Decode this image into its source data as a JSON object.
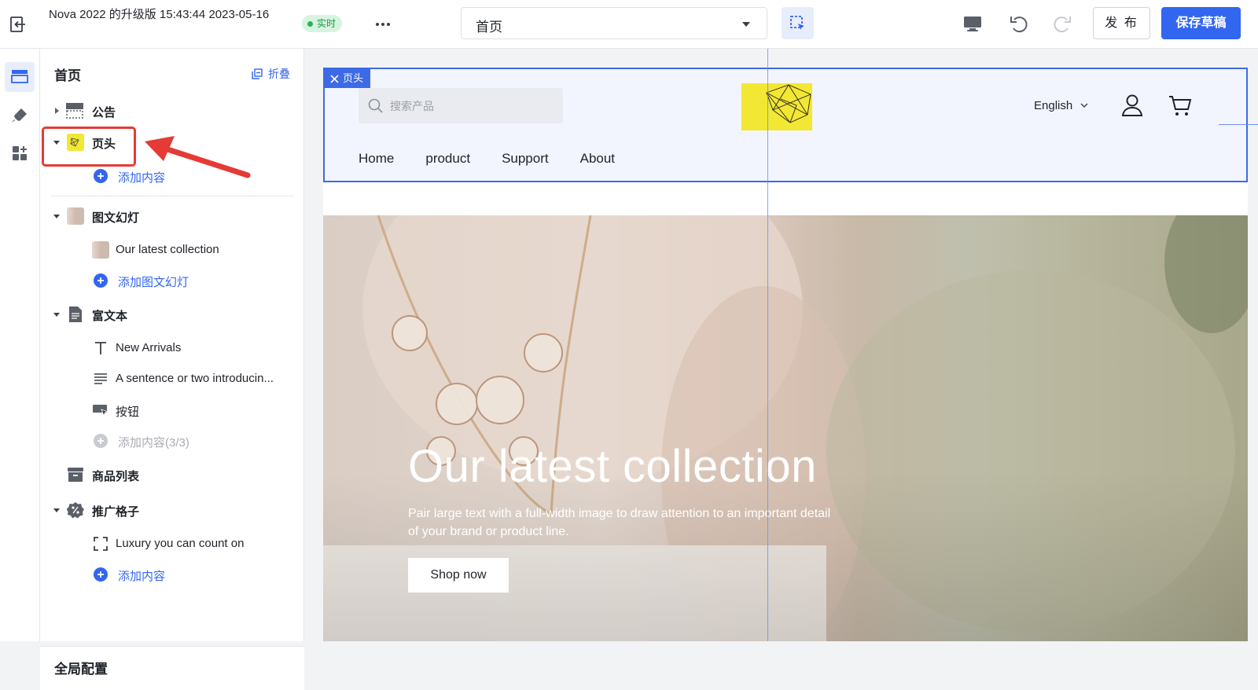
{
  "topbar": {
    "document_title": "Nova 2022 的升级版 15:43:44 2023-05-16",
    "live_badge": "实时",
    "page_selector_value": "首页",
    "publish_label": "发 布",
    "save_draft_label": "保存草稿"
  },
  "sidebar": {
    "title": "首页",
    "collapse_label": "折叠",
    "items": [
      {
        "label": "公告"
      },
      {
        "label": "页头",
        "children": [
          {
            "label": "添加内容"
          }
        ]
      },
      {
        "label": "图文幻灯",
        "children": [
          {
            "label": "Our latest collection"
          },
          {
            "label": "添加图文幻灯"
          }
        ]
      },
      {
        "label": "富文本",
        "children": [
          {
            "label": "New Arrivals"
          },
          {
            "label": "A sentence or two introducin..."
          },
          {
            "label": "按钮"
          },
          {
            "label": "添加内容(3/3)"
          }
        ]
      },
      {
        "label": "商品列表"
      },
      {
        "label": "推广格子",
        "children": [
          {
            "label": "Luxury you can count on"
          },
          {
            "label": "添加内容"
          }
        ]
      }
    ],
    "global_config": "全局配置"
  },
  "preview": {
    "header_tag": "页头",
    "search_placeholder": "搜索产品",
    "language": "English",
    "nav": [
      "Home",
      "product",
      "Support",
      "About"
    ],
    "hero": {
      "title": "Our latest collection",
      "subtitle": "Pair large text with a full-width image to draw attention to an important detail of your brand or product line.",
      "cta": "Shop now"
    }
  },
  "colors": {
    "accent": "#3366f0",
    "live_badge_bg": "#d6f4df",
    "highlight_red": "#e53a35",
    "logo_yellow": "#f2e733"
  }
}
